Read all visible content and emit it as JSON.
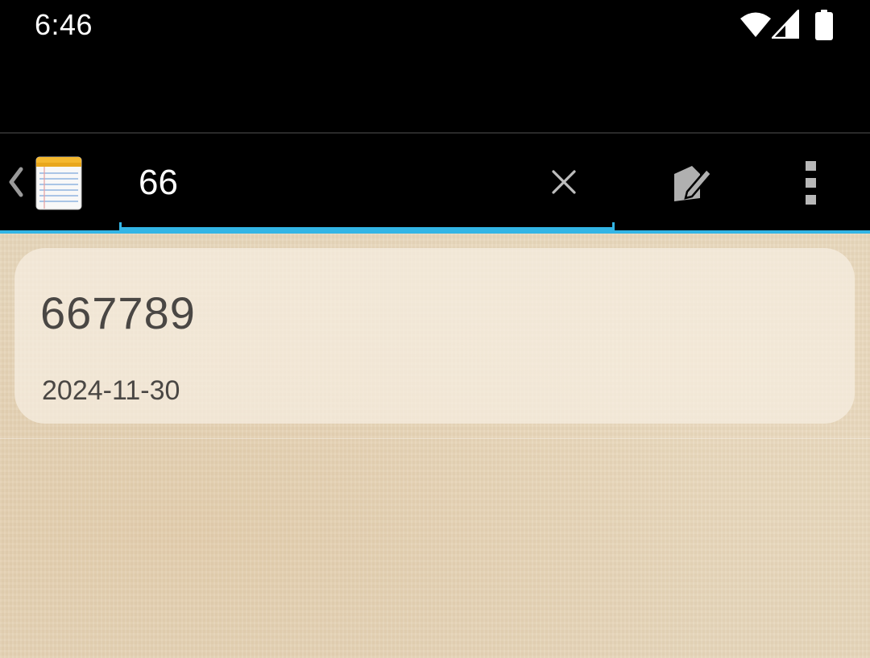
{
  "status_bar": {
    "time": "6:46",
    "icons": [
      "wifi-icon",
      "cellular-signal-icon",
      "battery-icon"
    ]
  },
  "action_bar": {
    "up_icon": "chevron-left-icon",
    "app_icon": "notepad-icon",
    "search": {
      "value": "66",
      "placeholder": ""
    },
    "clear_icon": "close-icon",
    "compose_icon": "compose-note-icon",
    "overflow_icon": "overflow-menu-icon"
  },
  "notes": [
    {
      "title": "667789",
      "date": "2024-11-30"
    }
  ],
  "colors": {
    "accent": "#33b5e5",
    "text": "#4a4744",
    "paper": "#e6d6bb"
  }
}
